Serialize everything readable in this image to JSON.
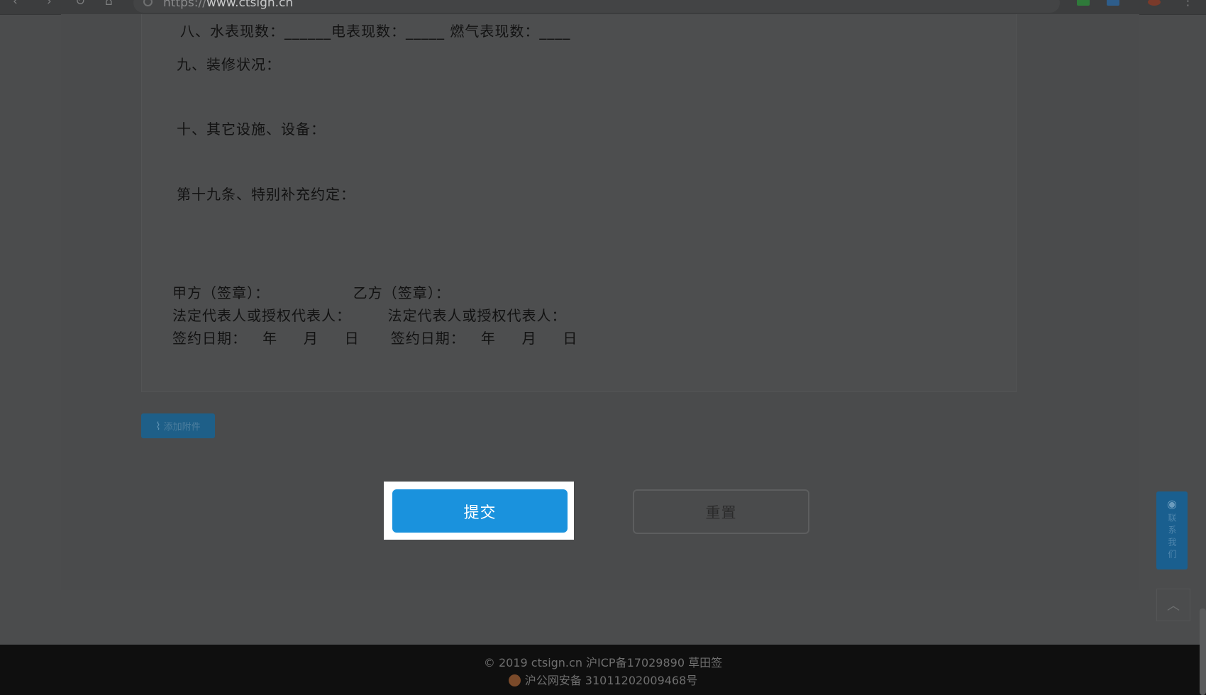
{
  "browser": {
    "url_prefix": "https://",
    "url_domain": "www.ctsign.cn",
    "icons": [
      "back-icon",
      "forward-icon",
      "reload-icon",
      "home-icon"
    ]
  },
  "document": {
    "lines": [
      "八、水表现数：______电表现数：_____ 燃气表现数：____",
      "九、装修状况：",
      "十、其它设施、设备：",
      "第十九条、特别补充约定：",
      "甲方（签章）：                乙方（签章）：",
      "法定代表人或授权代表人：       法定代表人或授权代表人：",
      "签约日期：   年     月     日      签约日期：   年     月     日"
    ]
  },
  "attach_label": "添加附件",
  "submit_label": "提交",
  "reset_label": "重置",
  "contact_label": "联系我们",
  "footer": {
    "line1": "© 2019 ctsign.cn 沪ICP备17029890 草田签",
    "line2": "沪公网安备 31011202009468号"
  },
  "colors": {
    "accent": "#1a92dd",
    "overlay": "#4b4c4d",
    "footer_bg": "#0f0f0f"
  }
}
